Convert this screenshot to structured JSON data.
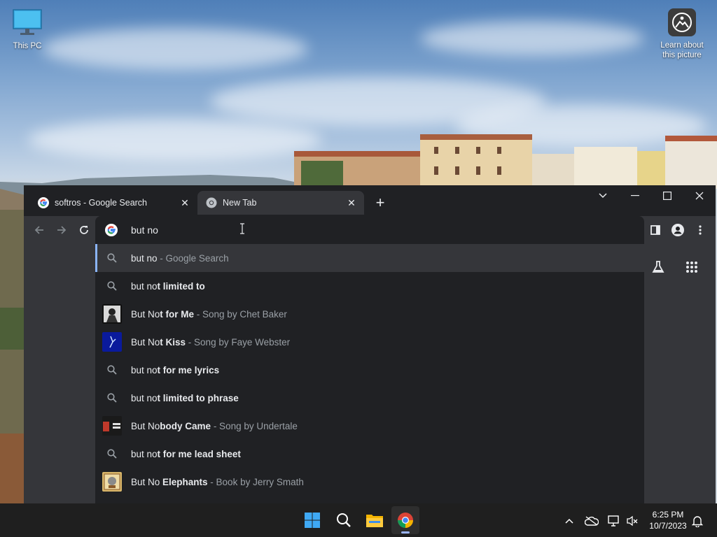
{
  "desktop": {
    "icons": {
      "this_pc": "This PC",
      "learn_line1": "Learn about",
      "learn_line2": "this picture"
    }
  },
  "browser": {
    "tabs": [
      {
        "title": "softros - Google Search",
        "active": false
      },
      {
        "title": "New Tab",
        "active": true
      }
    ],
    "omnibox": {
      "value": "but no",
      "suggestions": [
        {
          "icon": "search-icon",
          "plain": "but no",
          "bold": "",
          "sub": " - Google Search",
          "selected": true
        },
        {
          "icon": "search-icon",
          "plain": "but no",
          "bold": "t limited to",
          "sub": ""
        },
        {
          "icon": "album-thumbnail",
          "plain": "But No",
          "bold": "t for Me",
          "sub": " - Song by Chet Baker"
        },
        {
          "icon": "album-thumbnail",
          "plain": "But No",
          "bold": "t Kiss",
          "sub": " - Song by Faye Webster"
        },
        {
          "icon": "search-icon",
          "plain": "but no",
          "bold": "t for me lyrics",
          "sub": ""
        },
        {
          "icon": "search-icon",
          "plain": "but no",
          "bold": "t limited to phrase",
          "sub": ""
        },
        {
          "icon": "album-thumbnail",
          "plain": "But No",
          "bold": "body Came",
          "sub": " - Song by Undertale"
        },
        {
          "icon": "search-icon",
          "plain": "but no",
          "bold": "t for me lead sheet",
          "sub": ""
        },
        {
          "icon": "book-thumbnail",
          "plain": "But No ",
          "bold": "Elephants",
          "sub": " - Book by Jerry Smath"
        }
      ]
    }
  },
  "taskbar": {
    "time": "6:25 PM",
    "date": "10/7/2023"
  },
  "colors": {
    "chrome_dark": "#202124",
    "toolbar": "#35363a",
    "accent": "#8ab4f8",
    "text": "#e8eaed",
    "subtext": "#9aa0a6"
  }
}
